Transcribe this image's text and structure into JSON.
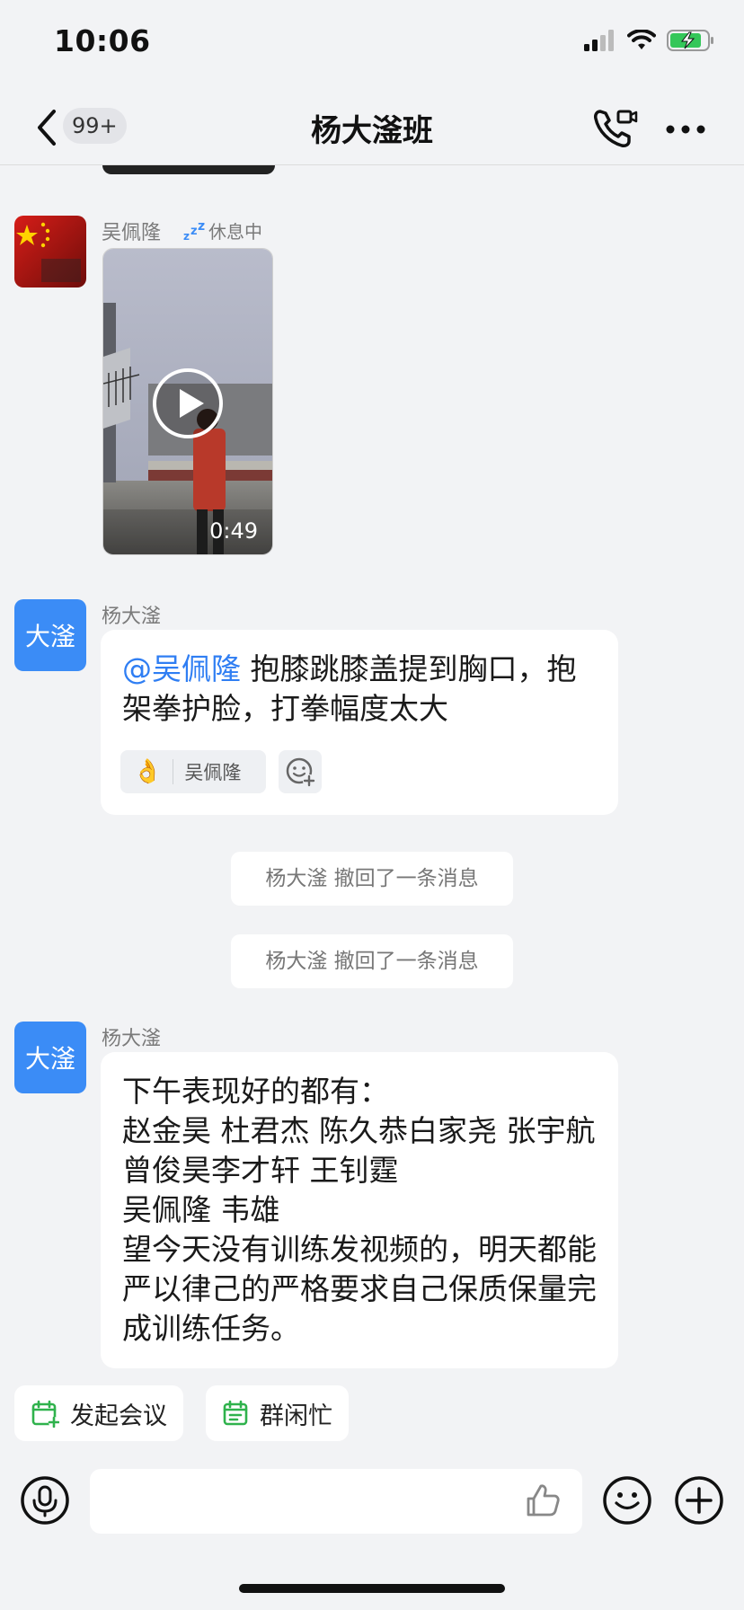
{
  "status_bar": {
    "time": "10:06",
    "icons": [
      "signal-icon",
      "wifi-icon",
      "battery-charging-icon"
    ],
    "battery_color": "#34c759"
  },
  "nav": {
    "back_icon": "chevron-left-icon",
    "unread_badge": "99+",
    "title": "杨大滏班",
    "call_icon": "phone-video-icon",
    "more_icon": "more-dots-icon"
  },
  "messages": [
    {
      "type": "video",
      "sender": "吴佩隆",
      "status": "休息中",
      "status_icon": "zzz-icon",
      "avatar": "flag-avatar",
      "duration": "0:49"
    },
    {
      "type": "text",
      "sender": "杨大滏",
      "avatar_text": "大滏",
      "mention": "@吴佩隆",
      "text": " 抱膝跳膝盖提到胸口，抱架拳护脸，打拳幅度太大",
      "reaction": {
        "emoji": "👌",
        "user": "吴佩隆"
      }
    },
    {
      "type": "recall",
      "text": "杨大滏 撤回了一条消息"
    },
    {
      "type": "recall",
      "text": "杨大滏 撤回了一条消息"
    },
    {
      "type": "text",
      "sender": "杨大滏",
      "avatar_text": "大滏",
      "lines": [
        "下午表现好的都有：",
        "赵金昊 杜君杰 陈久恭白家尧 张宇航 曾俊昊李才轩 王钊霆",
        "吴佩隆 韦雄",
        "望今天没有训练发视频的，明天都能严以律己的严格要求自己保质保量完成训练任务。"
      ]
    }
  ],
  "quick_actions": [
    {
      "label": "发起会议",
      "icon": "calendar-add-icon"
    },
    {
      "label": "群闲忙",
      "icon": "calendar-status-icon"
    }
  ],
  "input_bar": {
    "placeholder": "",
    "voice_icon": "microphone-icon",
    "like_icon": "thumbs-up-icon",
    "emoji_icon": "emoji-icon",
    "plus_icon": "plus-icon"
  },
  "colors": {
    "accent": "#3b8cf6",
    "mention": "#2f7ef3",
    "quick_icon": "#2fb24c"
  }
}
